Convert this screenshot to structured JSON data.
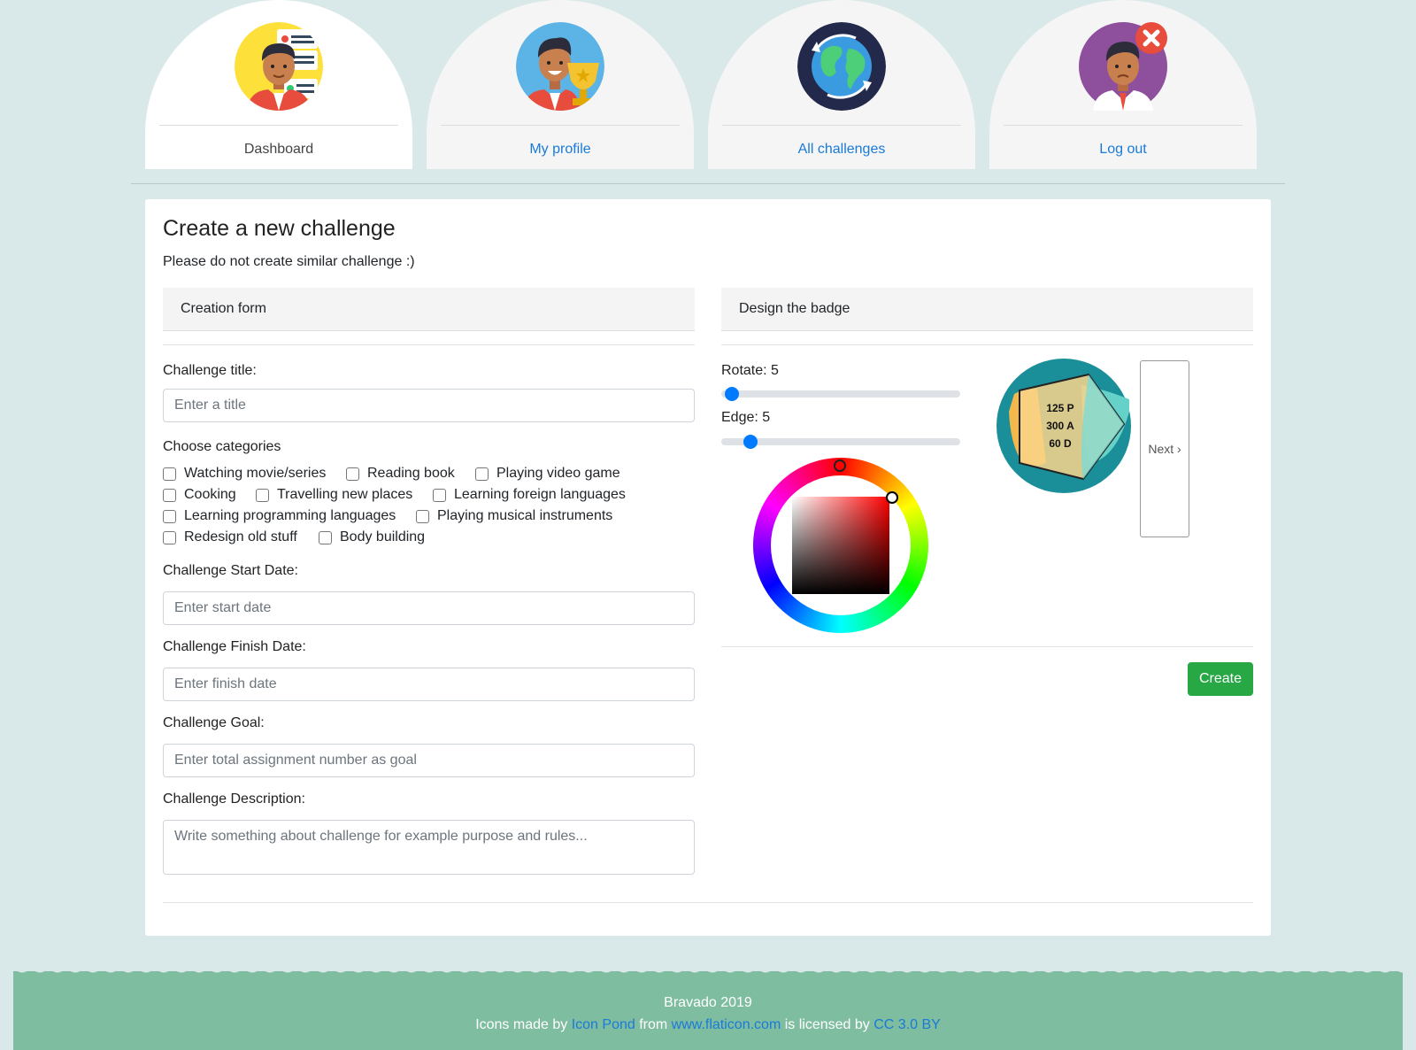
{
  "nav": {
    "tabs": [
      {
        "label": "Dashboard",
        "icon": "dashboard-avatar-icon",
        "active": true
      },
      {
        "label": "My profile",
        "icon": "profile-trophy-avatar-icon",
        "active": false
      },
      {
        "label": "All challenges",
        "icon": "globe-icon",
        "active": false
      },
      {
        "label": "Log out",
        "icon": "logout-avatar-icon",
        "active": false
      }
    ]
  },
  "page": {
    "title": "Create a new challenge",
    "subtitle": "Please do not create similar challenge :)"
  },
  "form": {
    "header": "Creation form",
    "title_label": "Challenge title:",
    "title_placeholder": "Enter a title",
    "categories_label": "Choose categories",
    "categories": [
      "Watching movie/series",
      "Reading book",
      "Playing video game",
      "Cooking",
      "Travelling new places",
      "Learning foreign languages",
      "Learning programming languages",
      "Playing musical instruments",
      "Redesign old stuff",
      "Body building"
    ],
    "start_label": "Challenge Start Date:",
    "start_placeholder": "Enter start date",
    "finish_label": "Challenge Finish Date:",
    "finish_placeholder": "Enter finish date",
    "goal_label": "Challenge Goal:",
    "goal_placeholder": "Enter total assignment number as goal",
    "desc_label": "Challenge Description:",
    "desc_placeholder": "Write something about challenge for example purpose and rules..."
  },
  "badge": {
    "header": "Design the badge",
    "rotate_label": "Rotate: 5",
    "rotate_value": 5,
    "edge_label": "Edge: 5",
    "edge_value": 5,
    "selected_color": "#ff0000",
    "preview_lines": [
      "125 P",
      "300 A",
      "60 D"
    ],
    "next_label": "Next ›",
    "create_label": "Create"
  },
  "footer": {
    "brand": "Bravado 2019",
    "credit_prefix": "Icons made by",
    "author": "Icon Pond",
    "from": "from",
    "site": "www.flaticon.com",
    "licensed": "is licensed by",
    "license": "CC 3.0 BY"
  },
  "colors": {
    "background": "#d9e8e8",
    "link": "#1a7ad8",
    "slider": "#007bff",
    "create_button": "#28a745",
    "footer": "#7fbda0"
  }
}
